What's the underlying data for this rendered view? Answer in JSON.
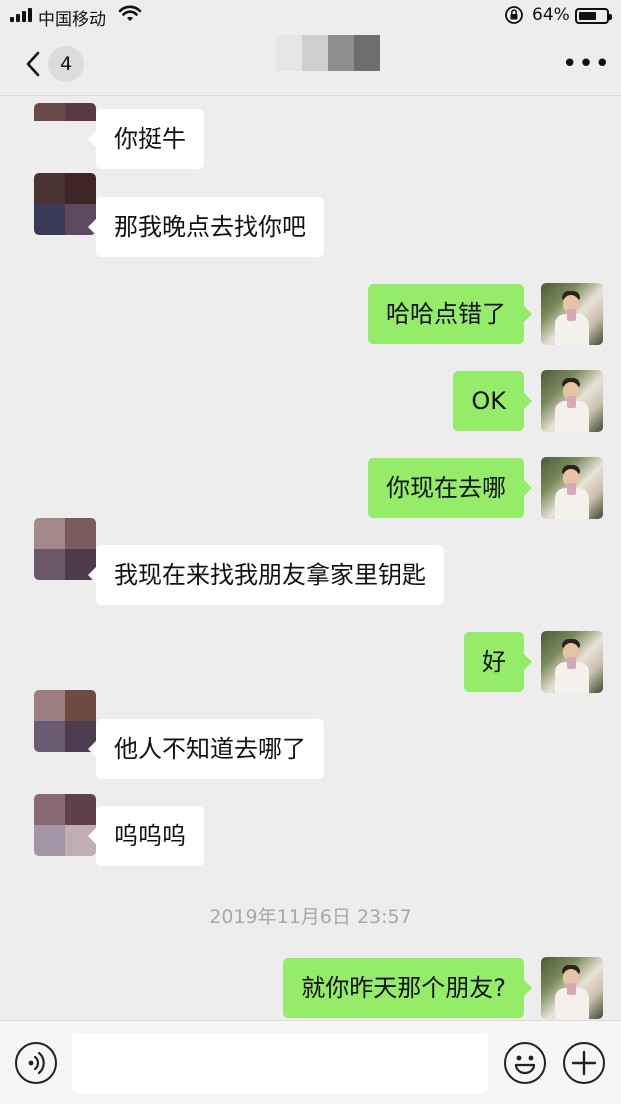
{
  "status_bar": {
    "carrier": "中国移动",
    "battery_percent": "64%",
    "battery_level": 0.64,
    "icons": [
      "signal-icon",
      "wifi-icon",
      "orientation-lock-icon",
      "battery-icon"
    ]
  },
  "nav": {
    "back_icon": "chevron-left-icon",
    "unread_count": "4",
    "more_icon": "ellipsis-icon"
  },
  "messages": [
    {
      "side": "in",
      "text": "你挺牛"
    },
    {
      "side": "in",
      "text": "那我晚点去找你吧"
    },
    {
      "side": "out",
      "text": "哈哈点错了"
    },
    {
      "side": "out",
      "text": "OK"
    },
    {
      "side": "out",
      "text": "你现在去哪"
    },
    {
      "side": "in",
      "text": "我现在来找我朋友拿家里钥匙"
    },
    {
      "side": "out",
      "text": "好"
    },
    {
      "side": "in",
      "text": "他人不知道去哪了"
    },
    {
      "side": "in",
      "text": "呜呜呜"
    },
    {
      "side": "out",
      "text": "就你昨天那个朋友?"
    }
  ],
  "timestamp": "2019年11月6日 23:57",
  "input_bar": {
    "voice_icon": "voice-icon",
    "emoji_icon": "emoji-icon",
    "plus_icon": "plus-icon",
    "text_value": ""
  },
  "colors": {
    "background": "#ededed",
    "outgoing_bubble": "#95ec69",
    "incoming_bubble": "#ffffff"
  }
}
